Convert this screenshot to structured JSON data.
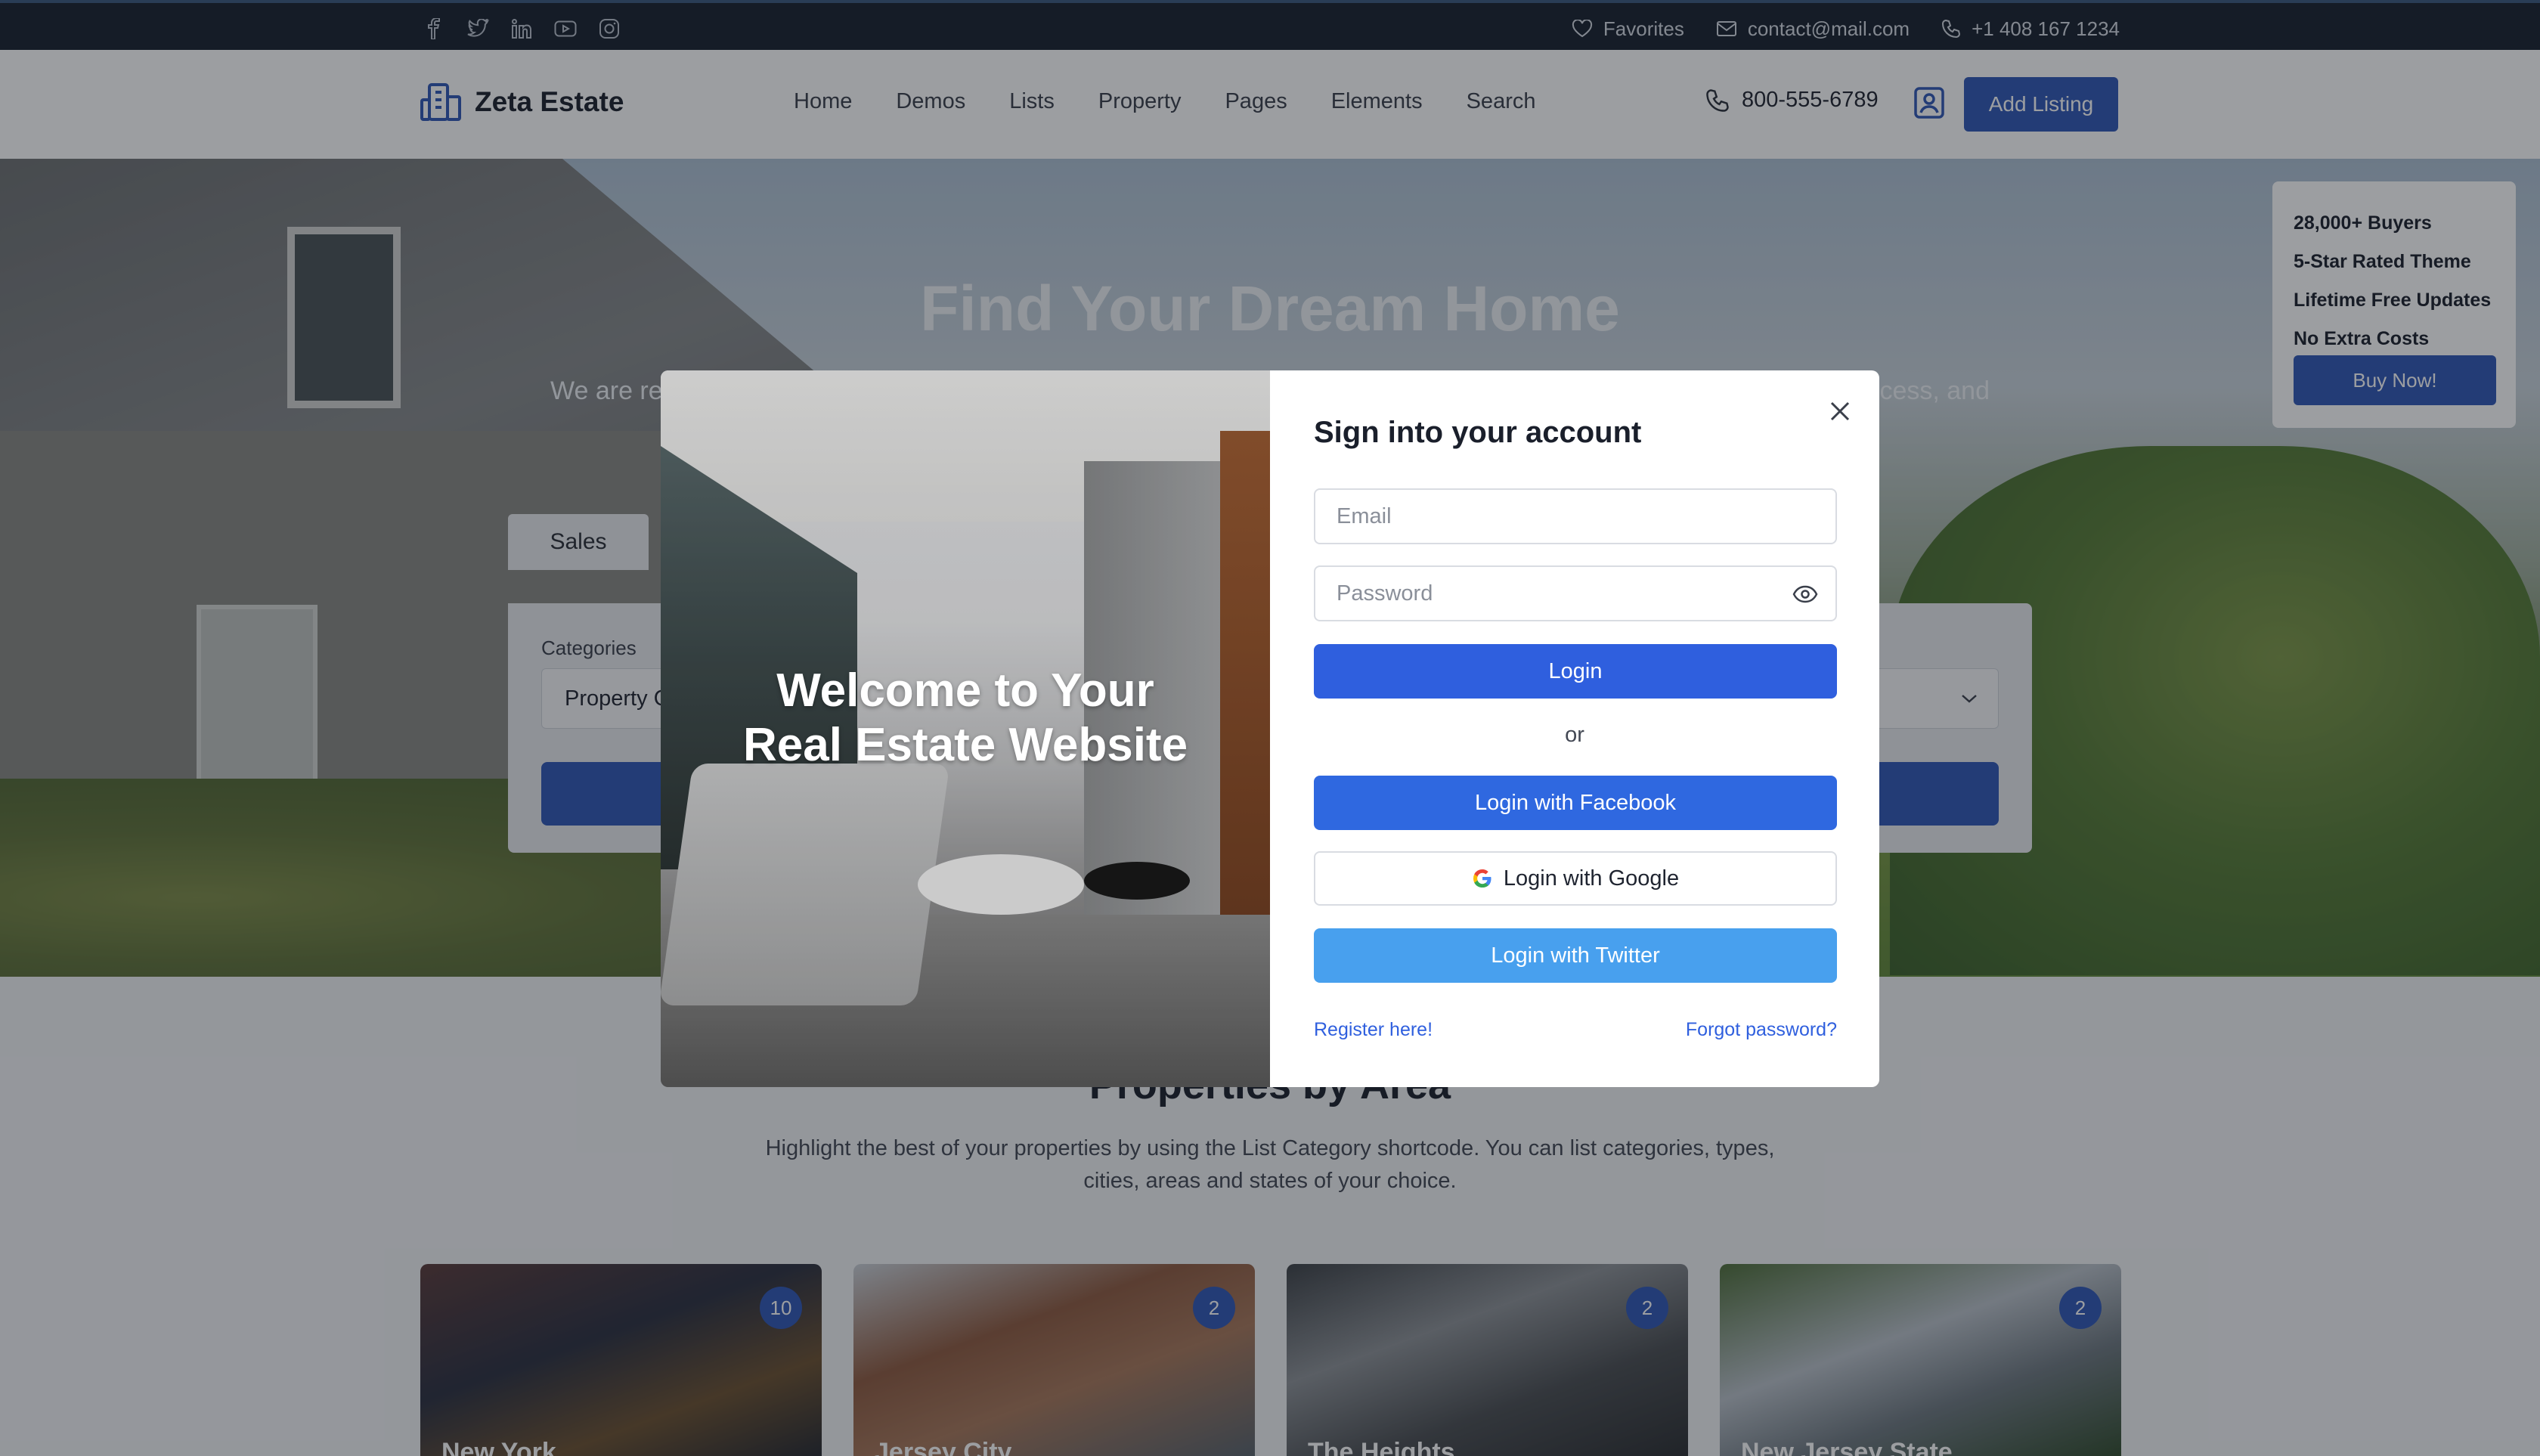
{
  "topbar": {
    "social_icons": [
      "facebook-icon",
      "twitter-icon",
      "linkedin-icon",
      "youtube-icon",
      "instagram-icon"
    ],
    "favorites_label": "Favorites",
    "email": "contact@mail.com",
    "phone": "+1 408 167 1234"
  },
  "header": {
    "brand": "Zeta Estate",
    "nav": [
      "Home",
      "Demos",
      "Lists",
      "Property",
      "Pages",
      "Elements",
      "Search"
    ],
    "phone": "800-555-6789",
    "add_listing": "Add Listing"
  },
  "hero": {
    "title": "Find Your Dream Home",
    "subtitle_left": "We are re",
    "subtitle_right": "cess, and",
    "tab": "Sales",
    "categories_label": "Categories",
    "categories_value": "Property C"
  },
  "promo": {
    "items": [
      "28,000+ Buyers",
      "5-Star Rated Theme",
      "Lifetime Free Updates",
      "No Extra Costs"
    ],
    "button": "Buy Now!"
  },
  "properties": {
    "title": "Properties by Area",
    "description": "Highlight the best of your properties by using the List Category shortcode. You can list categories, types, cities, areas and states of your choice.",
    "cards": [
      {
        "name": "New York",
        "count": "10"
      },
      {
        "name": "Jersey City",
        "count": "2"
      },
      {
        "name": "The Heights",
        "count": "2"
      },
      {
        "name": "New Jersey State",
        "count": "2"
      }
    ]
  },
  "modal": {
    "welcome_line1": "Welcome to Your",
    "welcome_line2": "Real Estate Website",
    "title": "Sign into your account",
    "email_placeholder": "Email",
    "password_placeholder": "Password",
    "login": "Login",
    "or": "or",
    "facebook": "Login with Facebook",
    "google": "Login with Google",
    "twitter": "Login with Twitter",
    "register": "Register here!",
    "forgot": "Forgot password?"
  },
  "colors": {
    "primary": "#2f56b6",
    "login_blue": "#2f5fde",
    "facebook_blue": "#2f68e0",
    "twitter_blue": "#48a0ee",
    "topbar_bg": "#17202e"
  }
}
